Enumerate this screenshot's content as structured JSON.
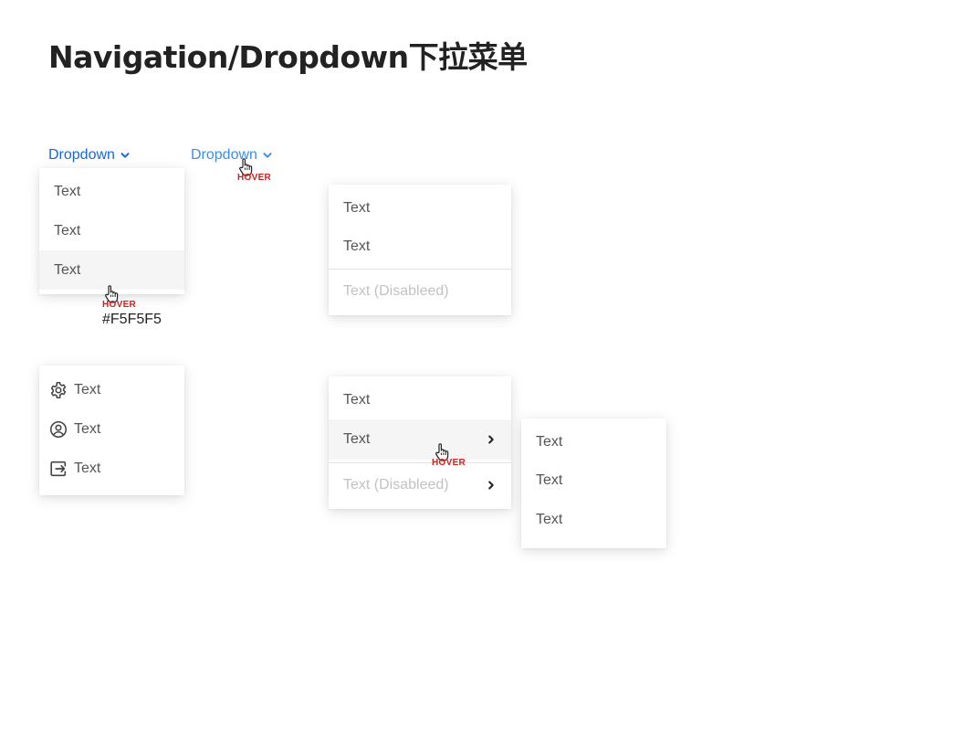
{
  "title": "Navigation/Dropdown下拉菜单",
  "trigger_default": "Dropdown",
  "trigger_hover": "Dropdown",
  "hover_label": "HOVER",
  "hover_color": "#F5F5F5",
  "colors": {
    "link": "#1a66d6",
    "link_hover": "#3d8ee8",
    "hover_bg": "#f5f5f5",
    "disabled": "#c2c2c2",
    "hover_tag": "#d41f1f"
  },
  "menu_basic": [
    "Text",
    "Text",
    "Text"
  ],
  "menu_disabled": {
    "items": [
      "Text",
      "Text"
    ],
    "disabled_item": "Text (Disableed)"
  },
  "menu_icons": [
    {
      "icon": "gear-icon",
      "label": "Text"
    },
    {
      "icon": "user-circle-icon",
      "label": "Text"
    },
    {
      "icon": "logout-icon",
      "label": "Text"
    }
  ],
  "menu_nested": {
    "items": [
      "Text",
      "Text"
    ],
    "disabled_item": "Text (Disableed)"
  },
  "submenu": [
    "Text",
    "Text",
    "Text"
  ]
}
